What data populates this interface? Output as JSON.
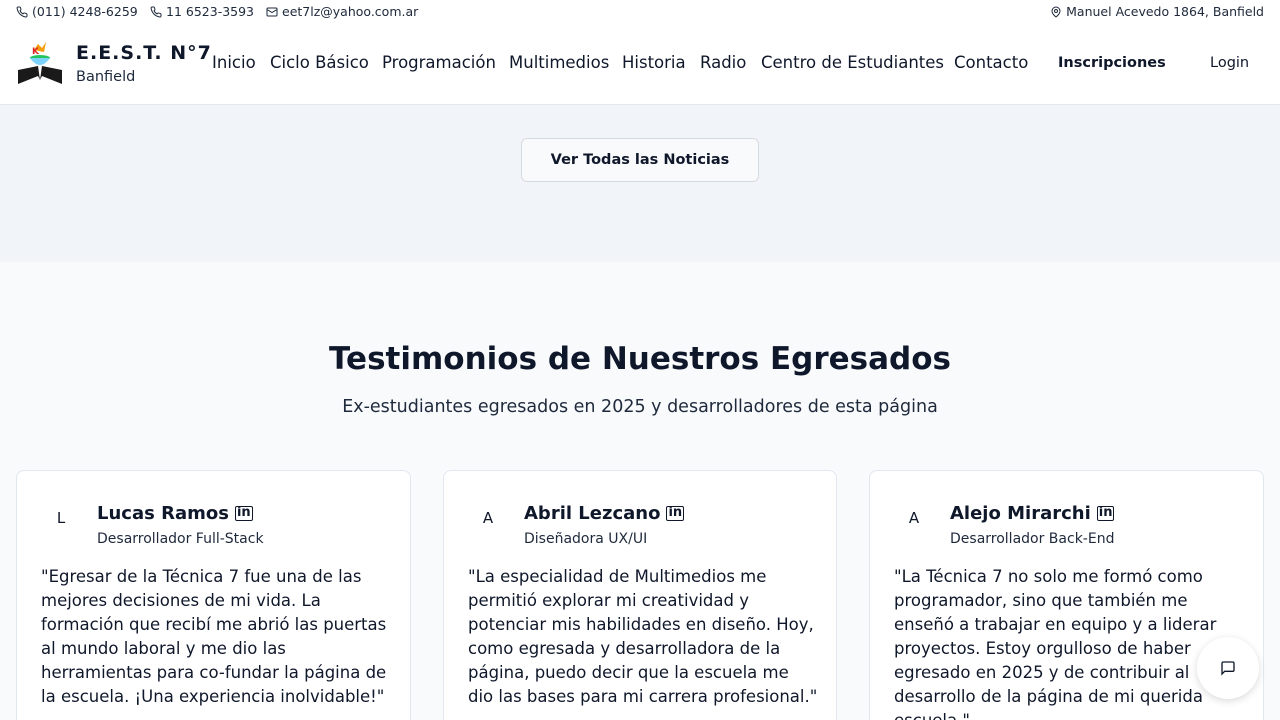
{
  "topbar": {
    "phone1": "(011) 4248-6259",
    "phone2": "11 6523-3593",
    "email": "eet7lz@yahoo.com.ar",
    "address": "Manuel Acevedo 1864, Banfield"
  },
  "brand": {
    "title": "E.E.S.T. N°7",
    "subtitle": "Banfield"
  },
  "nav": {
    "links": [
      "Inicio",
      "Ciclo Básico",
      "Programación",
      "Multimedios",
      "Historia",
      "Radio",
      "Centro de Estudiantes",
      "Contacto"
    ],
    "inscripciones": "Inscripciones",
    "login": "Login"
  },
  "news": {
    "button": "Ver Todas las Noticias"
  },
  "testimonials": {
    "title": "Testimonios de Nuestros Egresados",
    "subtitle": "Ex-estudiantes egresados en 2025 y desarrolladores de esta página",
    "cards": [
      {
        "initial": "L",
        "name": "Lucas Ramos",
        "role": "Desarrollador Full-Stack",
        "quote": "\"Egresar de la Técnica 7 fue una de las mejores decisiones de mi vida. La formación que recibí me abrió las puertas al mundo laboral y me dio las herramientas para co-fundar la página de la escuela. ¡Una experiencia inolvidable!\""
      },
      {
        "initial": "A",
        "name": "Abril Lezcano",
        "role": "Diseñadora UX/UI",
        "quote": "\"La especialidad de Multimedios me permitió explorar mi creatividad y potenciar mis habilidades en diseño. Hoy, como egresada y desarrolladora de la página, puedo decir que la escuela me dio las bases para mi carrera profesional.\""
      },
      {
        "initial": "A",
        "name": "Alejo Mirarchi",
        "role": "Desarrollador Back-End",
        "quote": "\"La Técnica 7 no solo me formó como programador, sino que también me enseñó a trabajar en equipo y a liderar proyectos. Estoy orgulloso de haber egresado en 2025 y de contribuir al desarrollo de la página de mi querida escuela.\""
      }
    ]
  }
}
